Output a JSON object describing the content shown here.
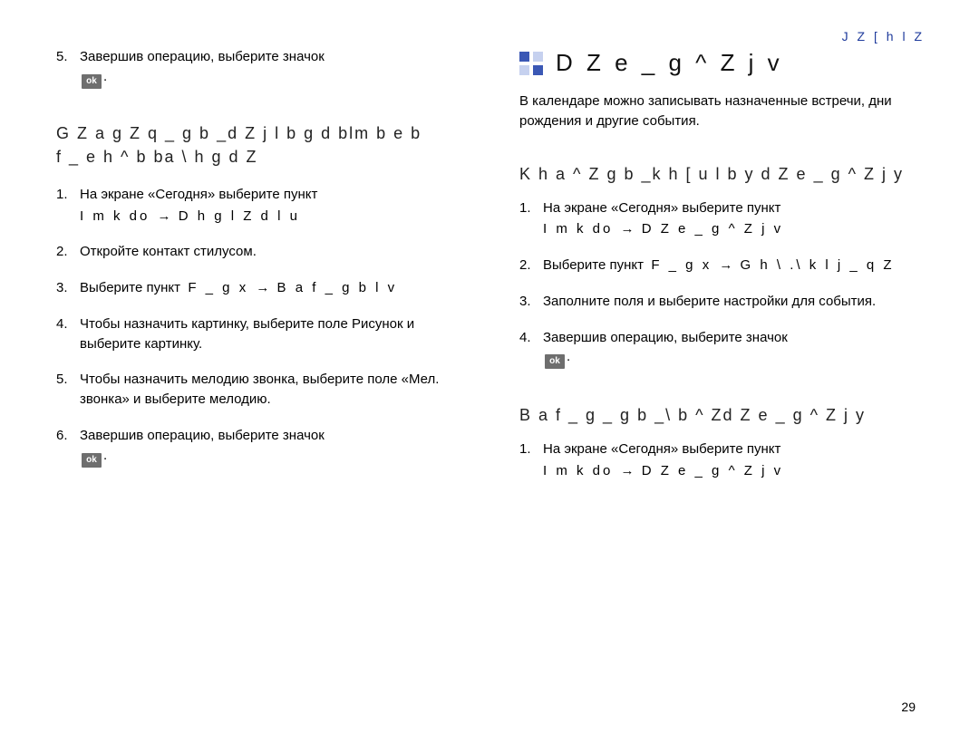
{
  "header_label": "J Z [ h l Z",
  "left": {
    "top_step": {
      "num": "5.",
      "text_before": "Завершив операцию, выберите значок",
      "ok_label": "ok",
      "after": "."
    },
    "subhead_lines": [
      "G Z a g Z q _ g b _d Z j l b g d blm b e b",
      "f _ e h ^ b ba \\ h g d Z"
    ],
    "steps": [
      {
        "num": "1.",
        "text": "На экране «Сегодня» выберите пункт",
        "menu": [
          {
            "seg": "I m k do"
          },
          {
            "arrow": "→"
          },
          {
            "seg": "D h g l Z d l u"
          }
        ]
      },
      {
        "num": "2.",
        "text": "Откройте контакт стилусом."
      },
      {
        "num": "3.",
        "text": "Выберите пункт",
        "inline_menu": [
          {
            "seg": "F _ g x"
          },
          {
            "arrow": "→"
          },
          {
            "seg": "B a f _ g b l v"
          }
        ]
      },
      {
        "num": "4.",
        "text": "Чтобы назначить картинку, выберите поле Рисунок и выберите картинку."
      },
      {
        "num": "5.",
        "text": "Чтобы назначить мелодию звонка, выберите поле «Мел. звонка» и выберите мелодию."
      },
      {
        "num": "6.",
        "text_before": "Завершив операцию, выберите значок",
        "ok_label": "ok",
        "after": "."
      }
    ]
  },
  "right": {
    "h1": "D Z e _ g ^ Z j v",
    "intro": "В календаре можно записывать назначенные встречи, дни рождения и другие события.",
    "subhead_create": "K h a ^ Z g b _k h [ u l b y d Z e _ g ^ Z j y",
    "steps_create": [
      {
        "num": "1.",
        "text": "На экране «Сегодня» выберите пункт",
        "menu": [
          {
            "seg": "I m k do"
          },
          {
            "arrow": "→"
          },
          {
            "seg": "D Z e _ g ^ Z j v"
          }
        ]
      },
      {
        "num": "2.",
        "text": "Выберите пункт",
        "inline_menu": [
          {
            "seg": "F _ g x"
          },
          {
            "arrow": "→"
          },
          {
            "seg": "G h \\ .\\ k l j _ q Z"
          }
        ]
      },
      {
        "num": "3.",
        "text": "Заполните поля и выберите настройки для события."
      },
      {
        "num": "4.",
        "text_before": "Завершив операцию, выберите значок",
        "ok_label": "ok",
        "after": "."
      }
    ],
    "subhead_view": "B a f _ g _ g b _\\ b ^ Zd Z e _ g ^ Z j y",
    "steps_view": [
      {
        "num": "1.",
        "text": "На экране «Сегодня» выберите пункт",
        "menu": [
          {
            "seg": "I m k do"
          },
          {
            "arrow": "→"
          },
          {
            "seg": "D Z e _ g ^ Z j v"
          }
        ]
      }
    ]
  },
  "page_number": "29"
}
